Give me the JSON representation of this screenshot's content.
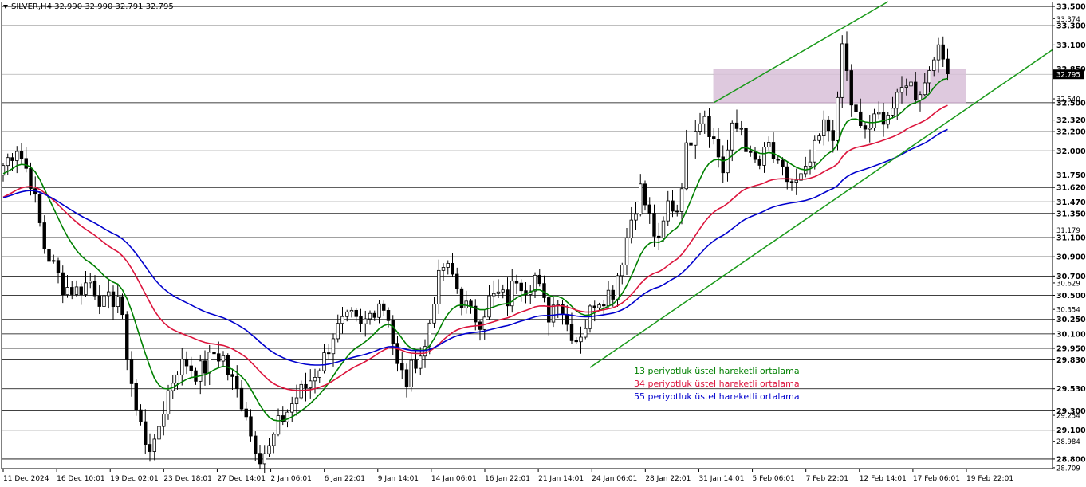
{
  "header": {
    "symbol": "SILVER,H4",
    "open": "32.990",
    "high": "32.990",
    "low": "32.791",
    "close": "32.795"
  },
  "legend": [
    {
      "text": "13 periyotluk üstel hareketli ortalama",
      "color": "#008000"
    },
    {
      "text": "34 periyotluk üstel hareketli ortalama",
      "color": "#dc143c"
    },
    {
      "text": "55 periyotluk üstel hareketli ortalama",
      "color": "#0000cd"
    }
  ],
  "chart_data": {
    "type": "candlestick",
    "symbol": "SILVER,H4",
    "ylim": [
      28.7,
      33.55
    ],
    "y_tick_labels": [
      "33.500",
      "33.374",
      "33.300",
      "33.100",
      "32.850",
      "32.795",
      "32.540",
      "32.500",
      "32.320",
      "32.200",
      "32.000",
      "31.750",
      "31.620",
      "31.470",
      "31.350",
      "31.179",
      "31.100",
      "30.900",
      "30.700",
      "30.629",
      "30.500",
      "30.354",
      "30.250",
      "30.100",
      "29.950",
      "29.830",
      "29.530",
      "29.300",
      "29.254",
      "29.100",
      "28.984",
      "28.800",
      "28.709"
    ],
    "horizontal_levels": [
      33.5,
      33.3,
      33.1,
      32.85,
      32.5,
      32.32,
      32.2,
      32.0,
      31.75,
      31.62,
      31.47,
      31.35,
      31.1,
      30.9,
      30.7,
      30.5,
      30.25,
      30.1,
      29.95,
      29.83,
      29.53,
      29.3,
      29.1,
      28.8
    ],
    "current_price": 32.795,
    "x_tick_labels": [
      "11 Dec 2024",
      "16 Dec 10:01",
      "19 Dec 02:01",
      "23 Dec 18:01",
      "27 Dec 14:01",
      "2 Jan 06:01",
      "6 Jan 22:01",
      "9 Jan 14:01",
      "14 Jan 06:01",
      "16 Jan 22:01",
      "21 Jan 14:01",
      "24 Jan 06:01",
      "28 Jan 22:01",
      "31 Jan 14:01",
      "5 Feb 06:01",
      "7 Feb 22:01",
      "12 Feb 14:01",
      "17 Feb 06:01",
      "19 Feb 22:01"
    ],
    "close_path": [
      [
        0,
        31.85
      ],
      [
        3,
        32.05
      ],
      [
        6,
        31.7
      ],
      [
        9,
        31.0
      ],
      [
        13,
        30.6
      ],
      [
        16,
        30.55
      ],
      [
        19,
        30.65
      ],
      [
        22,
        30.4
      ],
      [
        25,
        30.5
      ],
      [
        27,
        29.9
      ],
      [
        29,
        29.3
      ],
      [
        31,
        29.0
      ],
      [
        33,
        28.9
      ],
      [
        34,
        29.15
      ],
      [
        36,
        29.5
      ],
      [
        38,
        29.75
      ],
      [
        40,
        29.8
      ],
      [
        42,
        29.7
      ],
      [
        44,
        29.75
      ],
      [
        46,
        29.9
      ],
      [
        48,
        29.85
      ],
      [
        49,
        29.7
      ],
      [
        51,
        29.5
      ],
      [
        53,
        29.3
      ],
      [
        54,
        29.05
      ],
      [
        56,
        28.85
      ],
      [
        58,
        28.9
      ],
      [
        60,
        29.15
      ],
      [
        62,
        29.3
      ],
      [
        64,
        29.45
      ],
      [
        66,
        29.55
      ],
      [
        68,
        29.7
      ],
      [
        70,
        29.85
      ],
      [
        72,
        30.1
      ],
      [
        74,
        30.2
      ],
      [
        76,
        30.25
      ],
      [
        78,
        30.15
      ],
      [
        80,
        30.3
      ],
      [
        82,
        30.45
      ],
      [
        84,
        30.3
      ],
      [
        86,
        29.75
      ],
      [
        88,
        29.6
      ],
      [
        90,
        29.85
      ],
      [
        92,
        29.95
      ],
      [
        94,
        30.5
      ],
      [
        96,
        30.8
      ],
      [
        98,
        30.7
      ],
      [
        100,
        30.45
      ],
      [
        102,
        30.3
      ],
      [
        104,
        30.25
      ],
      [
        106,
        30.45
      ],
      [
        108,
        30.5
      ],
      [
        110,
        30.45
      ],
      [
        112,
        30.7
      ],
      [
        114,
        30.6
      ],
      [
        116,
        30.7
      ],
      [
        118,
        30.4
      ],
      [
        119,
        30.3
      ],
      [
        121,
        30.5
      ],
      [
        123,
        30.2
      ],
      [
        125,
        30.05
      ],
      [
        127,
        30.2
      ],
      [
        129,
        30.45
      ],
      [
        131,
        30.5
      ],
      [
        133,
        30.55
      ],
      [
        135,
        30.9
      ],
      [
        137,
        31.3
      ],
      [
        139,
        31.6
      ],
      [
        141,
        31.3
      ],
      [
        143,
        31.0
      ],
      [
        145,
        31.45
      ],
      [
        147,
        31.4
      ],
      [
        149,
        32.0
      ],
      [
        151,
        32.3
      ],
      [
        153,
        32.4
      ],
      [
        155,
        32.1
      ],
      [
        157,
        31.8
      ],
      [
        159,
        32.2
      ],
      [
        161,
        32.25
      ],
      [
        163,
        31.9
      ],
      [
        165,
        31.85
      ],
      [
        167,
        32.05
      ],
      [
        169,
        31.8
      ],
      [
        171,
        31.7
      ],
      [
        173,
        31.65
      ],
      [
        175,
        31.75
      ],
      [
        177,
        32.0
      ],
      [
        179,
        32.25
      ],
      [
        181,
        32.2
      ],
      [
        182,
        32.45
      ],
      [
        183,
        33.1
      ],
      [
        185,
        32.5
      ],
      [
        187,
        32.2
      ],
      [
        189,
        32.25
      ],
      [
        191,
        32.35
      ],
      [
        193,
        32.4
      ],
      [
        195,
        32.5
      ],
      [
        197,
        32.75
      ],
      [
        199,
        32.6
      ],
      [
        201,
        32.7
      ],
      [
        203,
        33.05
      ],
      [
        205,
        32.95
      ],
      [
        206,
        32.8
      ]
    ],
    "overlays": [
      {
        "type": "rectangle",
        "label": "resistance zone",
        "y_range": [
          32.5,
          32.85
        ],
        "color": "#d8bfd8"
      },
      {
        "type": "trendline",
        "label": "lower channel line",
        "color": "#008000"
      },
      {
        "type": "trendline",
        "label": "upper channel line",
        "color": "#008000"
      }
    ],
    "series": [
      {
        "name": "13 periyotluk üstel hareketli ortalama",
        "period": 13,
        "color": "#008000"
      },
      {
        "name": "34 periyotluk üstel hareketli ortalama",
        "period": 34,
        "color": "#dc143c"
      },
      {
        "name": "55 periyotluk üstel hareketli ortalama",
        "period": 55,
        "color": "#0000cd"
      }
    ],
    "axis_color": "#000000",
    "grid": "horizontal price levels",
    "background": "#ffffff"
  }
}
